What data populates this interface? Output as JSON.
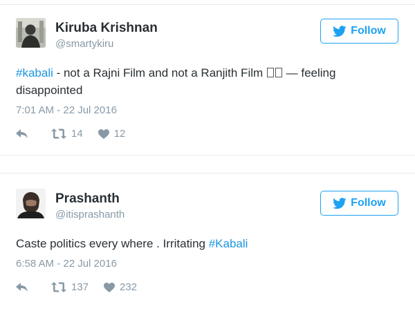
{
  "tweets": [
    {
      "name": "Kiruba Krishnan",
      "handle": "@smartykiru",
      "follow_label": "Follow",
      "hashtag": "#kabali",
      "text_after_hashtag": " - not a Rajni Film and not a Ranjith Film",
      "text_after_emoji": " — feeling disappointed",
      "timestamp": "7:01 AM - 22 Jul 2016",
      "retweets": "14",
      "likes": "12"
    },
    {
      "name": "Prashanth",
      "handle": "@itisprashanth",
      "follow_label": "Follow",
      "text_before_hashtag": "Caste politics every where . Irritating ",
      "hashtag": "#Kabali",
      "timestamp": "6:58 AM - 22 Jul 2016",
      "retweets": "137",
      "likes": "232"
    }
  ],
  "colors": {
    "accent": "#1da1f2",
    "hashtag": "#1b95e0",
    "muted": "#8899a6",
    "text": "#292f33",
    "separator": "#e6ecf0"
  },
  "icons": {
    "follow": "twitter-bird-icon",
    "reply": "reply-icon",
    "retweet": "retweet-icon",
    "like": "heart-icon"
  }
}
